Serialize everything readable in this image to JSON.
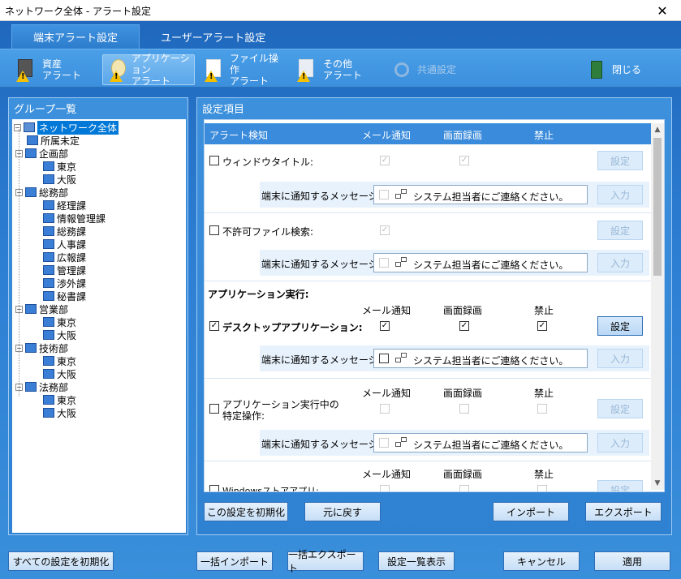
{
  "window": {
    "title": "ネットワーク全体 - アラート設定",
    "close_glyph": "✕"
  },
  "tabs": [
    {
      "label": "端末アラート設定"
    },
    {
      "label": "ユーザーアラート設定"
    }
  ],
  "toolbar": {
    "items": [
      {
        "line1": "資産",
        "line2": "アラート"
      },
      {
        "line1": "アプリケーション",
        "line2": "アラート"
      },
      {
        "line1": "ファイル操作",
        "line2": "アラート"
      },
      {
        "line1": "その他",
        "line2": "アラート"
      },
      {
        "line1": "共通設定",
        "line2": ""
      },
      {
        "line1": "閉じる",
        "line2": ""
      }
    ]
  },
  "group_panel": {
    "title": "グループ一覧",
    "nodes": [
      {
        "label": "ネットワーク全体"
      },
      {
        "label": "所属未定"
      },
      {
        "label": "企画部"
      },
      {
        "label": "東京"
      },
      {
        "label": "大阪"
      },
      {
        "label": "総務部"
      },
      {
        "label": "経理課"
      },
      {
        "label": "情報管理課"
      },
      {
        "label": "総務課"
      },
      {
        "label": "人事課"
      },
      {
        "label": "広報課"
      },
      {
        "label": "管理課"
      },
      {
        "label": "渉外課"
      },
      {
        "label": "秘書課"
      },
      {
        "label": "営業部"
      },
      {
        "label": "東京"
      },
      {
        "label": "大阪"
      },
      {
        "label": "技術部"
      },
      {
        "label": "東京"
      },
      {
        "label": "大阪"
      },
      {
        "label": "法務部"
      },
      {
        "label": "東京"
      },
      {
        "label": "大阪"
      }
    ]
  },
  "settings_panel": {
    "title": "設定項目",
    "header": {
      "c1": "アラート検知",
      "c2": "メール通知",
      "c3": "画面録画",
      "c4": "禁止"
    },
    "col_mail": "メール通知",
    "col_rec": "画面録画",
    "col_ban": "禁止",
    "msg_label": "端末に通知するメッセージ:",
    "msg_text": "システム担当者にご連絡ください。",
    "btn_setting": "設定",
    "btn_input": "入力",
    "rows": {
      "window_title": "ウィンドウタイトル:",
      "forbidden_file": "不許可ファイル検索:",
      "app_exec_section": "アプリケーション実行:",
      "desktop_app": "デスクトップアプリケーション:",
      "app_specific_1": "アプリケーション実行中の",
      "app_specific_2": "特定操作:",
      "store_app": "Windowsストアアプリ:"
    },
    "check_mark": "✓",
    "footer": {
      "reset": "この設定を初期化",
      "undo": "元に戻す",
      "import": "インポート",
      "export": "エクスポート"
    }
  },
  "bottom": {
    "reset_all": "すべての設定を初期化",
    "bulk_import": "一括インポート",
    "bulk_export": "一括エクスポート",
    "list_view": "設定一覧表示",
    "cancel": "キャンセル",
    "apply": "適用"
  }
}
